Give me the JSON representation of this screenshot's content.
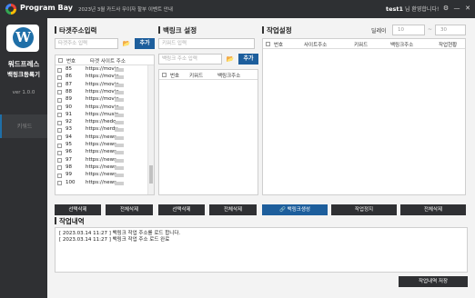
{
  "window": {
    "app_name": "Program Bay",
    "notice": "2023년 3월 카드사 무이자 할부 이벤트 안내",
    "user": "test1",
    "greeting": "님 환영합니다!",
    "controls": [
      "⚙",
      "—",
      "✕"
    ]
  },
  "sidebar": {
    "brand": "워드프레스",
    "subtitle": "백링크등록기",
    "version": "ver 1.0.0",
    "nav": [
      {
        "label": "키워드"
      }
    ]
  },
  "target_panel": {
    "title": "타겟주소입력",
    "input_placeholder": "타겟주소 입력",
    "add_label": "추가",
    "headers": [
      "번호",
      "타겟 사이트 주소"
    ],
    "rows": [
      {
        "num": "85",
        "url": "https://movie"
      },
      {
        "num": "86",
        "url": "https://movie"
      },
      {
        "num": "87",
        "url": "https://movie"
      },
      {
        "num": "88",
        "url": "https://movie"
      },
      {
        "num": "89",
        "url": "https://movie"
      },
      {
        "num": "90",
        "url": "https://movie"
      },
      {
        "num": "91",
        "url": "https://musin"
      },
      {
        "num": "92",
        "url": "https://hedo"
      },
      {
        "num": "93",
        "url": "https://nerdv"
      },
      {
        "num": "94",
        "url": "https://news-"
      },
      {
        "num": "95",
        "url": "https://news."
      },
      {
        "num": "96",
        "url": "https://news."
      },
      {
        "num": "97",
        "url": "https://news."
      },
      {
        "num": "98",
        "url": "https://news-"
      },
      {
        "num": "99",
        "url": "https://news."
      },
      {
        "num": "100",
        "url": "https://news"
      }
    ],
    "delete_selected": "선택삭제",
    "delete_all": "전체삭제"
  },
  "backlink_panel": {
    "title": "백링크 설정",
    "keyword_placeholder": "키워드 입력",
    "backlink_placeholder": "백링크 주소 입력",
    "add_label": "추가",
    "headers": [
      "번호",
      "키워드",
      "백링크주소"
    ],
    "delete_selected": "선택삭제",
    "delete_all": "전체삭제"
  },
  "job_panel": {
    "title": "작업설정",
    "delay_label": "딜레이",
    "delay_min": "10",
    "delay_sep": "~",
    "delay_max": "30",
    "headers": [
      "번호",
      "사이트주소",
      "키워드",
      "백링크주소",
      "작업현황"
    ],
    "create_label": "백링크생성",
    "stop_label": "작업정지",
    "delete_label": "전체삭제"
  },
  "log": {
    "title": "작업내역",
    "lines": [
      "[ 2023.03.14 11:27 ] 백링크 작업 주소를 로드 합니다.",
      "[ 2023.03.14 11:27 ] 백링크 작업 주소 로드 완료"
    ],
    "save_label": "작업내역 저장"
  },
  "colors": {
    "sidebar": "#2f3033",
    "accent": "#1d5e9c",
    "titlebar": "#2e3033"
  }
}
